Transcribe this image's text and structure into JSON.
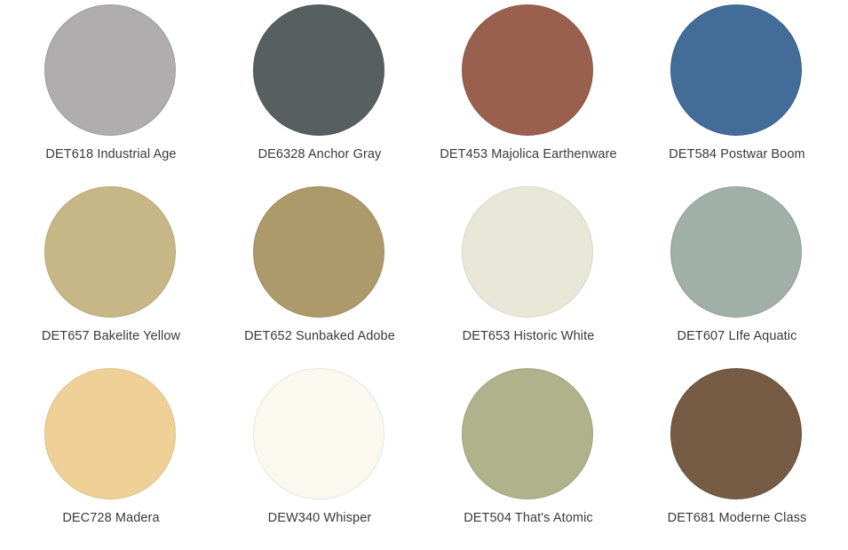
{
  "swatches": [
    {
      "label": "DET618 Industrial Age",
      "color": "#afadae",
      "border": "#9c9a9b"
    },
    {
      "label": "DE6328 Anchor Gray",
      "color": "#585f60",
      "border": "#4e5455"
    },
    {
      "label": "DET453 Majolica Earthenware",
      "color": "#99614d",
      "border": "#8a5644"
    },
    {
      "label": "DET584 Postwar Boom",
      "color": "#436c99",
      "border": "#3a6089"
    },
    {
      "label": "DET657 Bakelite Yellow",
      "color": "#c8b786",
      "border": "#b7a675"
    },
    {
      "label": "DET652 Sunbaked Adobe",
      "color": "#ad9a6a",
      "border": "#9c8a5d"
    },
    {
      "label": "DET653 Historic White",
      "color": "#e9e7d8",
      "border": "#d8d6c6"
    },
    {
      "label": "DET607 LIfe Aquatic",
      "color": "#a0b0a8",
      "border": "#909f97"
    },
    {
      "label": "DEC728 Madera",
      "color": "#efd198",
      "border": "#dcbf88"
    },
    {
      "label": "DEW340 Whisper",
      "color": "#faf8ef",
      "border": "#e6e4da"
    },
    {
      "label": "DET504 That's Atomic",
      "color": "#b0b28b",
      "border": "#9fa17b"
    },
    {
      "label": "DET681 Moderne Class",
      "color": "#765c44",
      "border": "#674f3a"
    }
  ]
}
